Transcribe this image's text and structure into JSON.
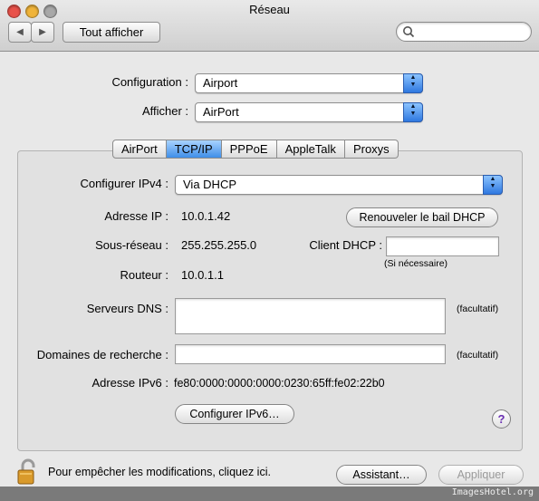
{
  "window": {
    "title": "Réseau"
  },
  "toolbar": {
    "show_all_label": "Tout afficher",
    "search_placeholder": ""
  },
  "top": {
    "configuration_label": "Configuration :",
    "configuration_value": "Airport",
    "show_label": "Afficher :",
    "show_value": "AirPort"
  },
  "tabs": [
    "AirPort",
    "TCP/IP",
    "PPPoE",
    "AppleTalk",
    "Proxys"
  ],
  "tcpip": {
    "configure_ipv4_label": "Configurer IPv4 :",
    "configure_ipv4_value": "Via DHCP",
    "ip_label": "Adresse IP :",
    "ip_value": "10.0.1.42",
    "renew_button": "Renouveler le bail DHCP",
    "subnet_label": "Sous-réseau :",
    "subnet_value": "255.255.255.0",
    "dhcp_client_label": "Client DHCP :",
    "dhcp_client_value": "",
    "if_needed": "(Si nécessaire)",
    "router_label": "Routeur :",
    "router_value": "10.0.1.1",
    "dns_label": "Serveurs DNS :",
    "dns_value": "",
    "optional": "(facultatif)",
    "search_domains_label": "Domaines de recherche :",
    "search_domains_value": "",
    "ipv6_label": "Adresse IPv6 :",
    "ipv6_value": "fe80:0000:0000:0000:0230:65ff:fe02:22b0",
    "configure_ipv6_button": "Configurer IPv6…"
  },
  "bottom": {
    "lock_text": "Pour empêcher les modifications, cliquez ici.",
    "assistant_button": "Assistant…",
    "apply_button": "Appliquer"
  },
  "watermark": "ImagesHotel.org",
  "colors": {
    "accent": "#3f8ee8",
    "close": "#e8524a",
    "minimize": "#f0b43a",
    "zoom": "#9a9a9a"
  }
}
